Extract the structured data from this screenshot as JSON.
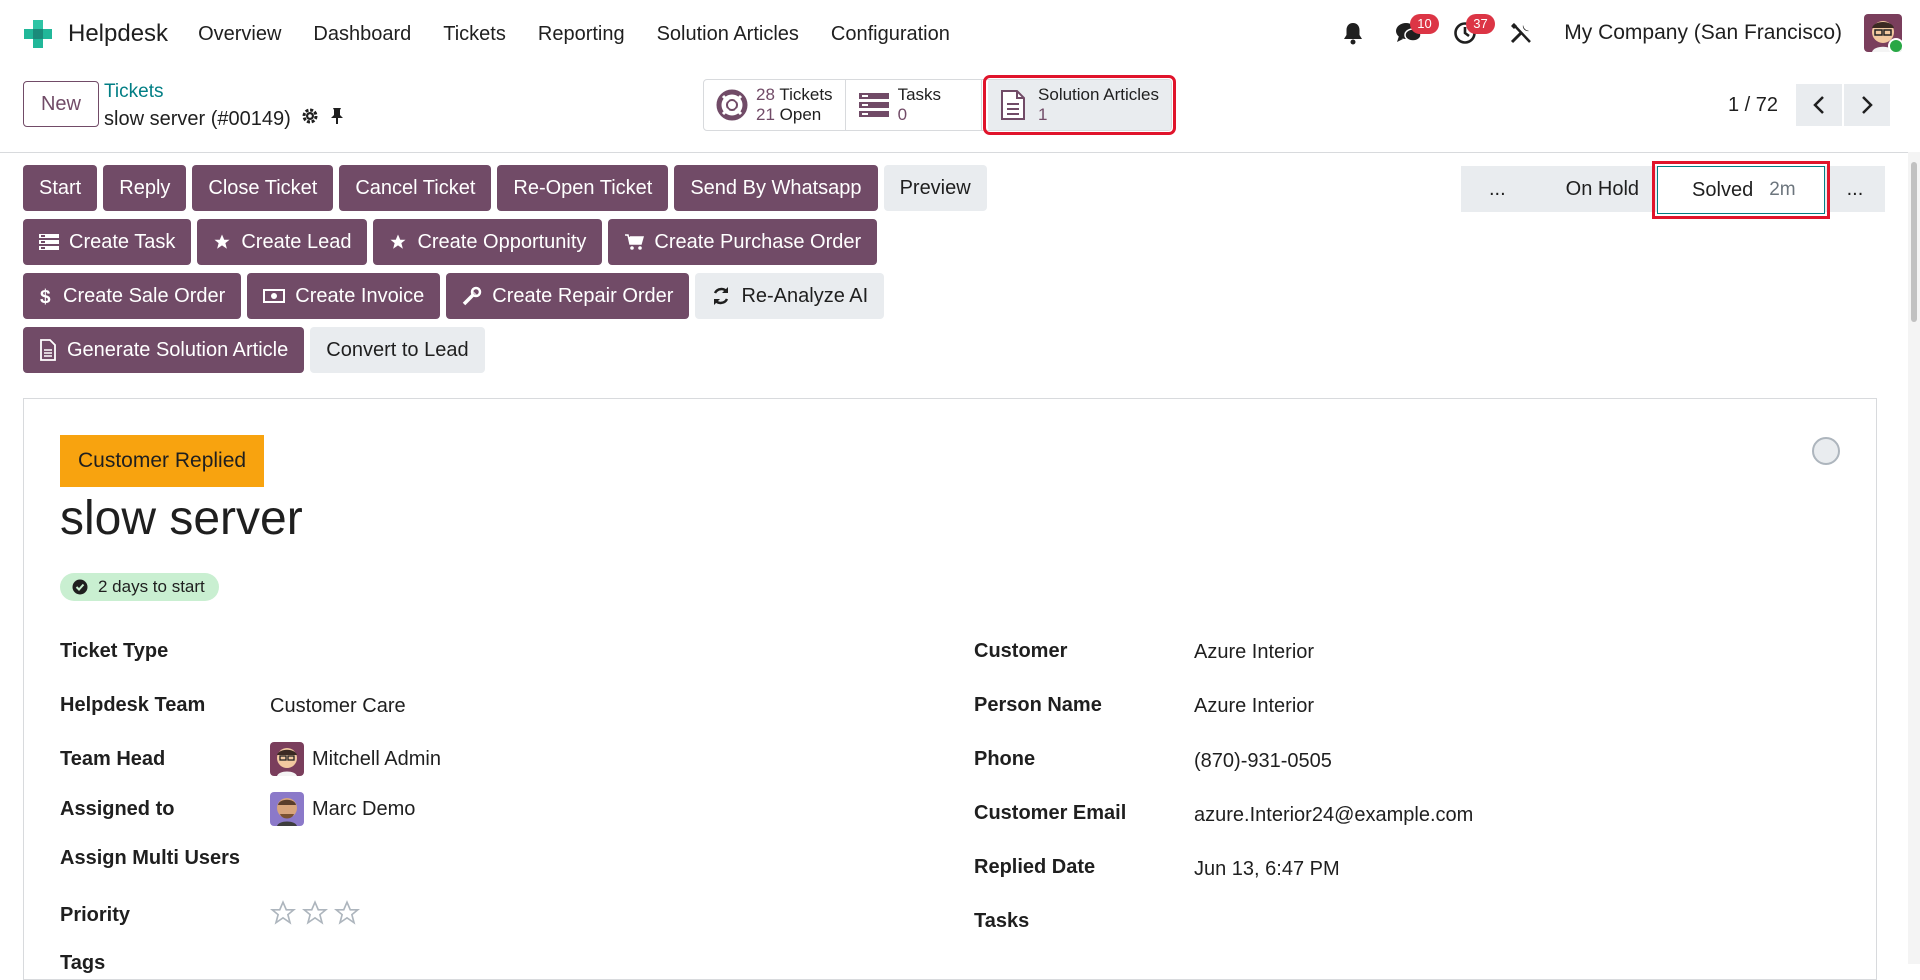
{
  "navbar": {
    "app_name": "Helpdesk",
    "menu": [
      "Overview",
      "Dashboard",
      "Tickets",
      "Reporting",
      "Solution Articles",
      "Configuration"
    ],
    "messages_count": "10",
    "activities_count": "37",
    "company": "My Company (San Francisco)"
  },
  "control": {
    "new_label": "New",
    "breadcrumb_parent": "Tickets",
    "record_name": "slow server (#00149)",
    "stats": {
      "tickets_num": "28",
      "tickets_label": "Tickets",
      "open_num": "21",
      "open_label": "Open",
      "tasks_label": "Tasks",
      "tasks_num": "0",
      "articles_label": "Solution Articles",
      "articles_num": "1"
    },
    "pager": "1 / 72"
  },
  "actions": {
    "row1": [
      "Start",
      "Reply",
      "Close Ticket",
      "Cancel Ticket",
      "Re-Open Ticket",
      "Send By Whatsapp",
      "Preview"
    ],
    "row2": [
      "Create Task",
      "Create Lead",
      "Create Opportunity",
      "Create Purchase Order"
    ],
    "row3": [
      "Create Sale Order",
      "Create Invoice",
      "Create Repair Order",
      "Re-Analyze AI"
    ],
    "row4": [
      "Generate Solution Article",
      "Convert to Lead"
    ]
  },
  "statusbar": {
    "prev_dots": "...",
    "on_hold": "On Hold",
    "solved": "Solved",
    "solved_time": "2m",
    "next_dots": "..."
  },
  "form": {
    "tag": "Customer Replied",
    "title": "slow server",
    "days_badge": "2 days to start",
    "left": {
      "ticket_type_label": "Ticket Type",
      "team_label": "Helpdesk Team",
      "team_value": "Customer Care",
      "team_head_label": "Team Head",
      "team_head_value": "Mitchell Admin",
      "assigned_label": "Assigned to",
      "assigned_value": "Marc Demo",
      "multi_users_label": "Assign Multi Users",
      "priority_label": "Priority",
      "priority_stars": 0,
      "priority_max": 3,
      "tags_label": "Tags"
    },
    "right": {
      "customer_label": "Customer",
      "customer_value": "Azure Interior",
      "person_label": "Person Name",
      "person_value": "Azure Interior",
      "phone_label": "Phone",
      "phone_value": "(870)-931-0505",
      "email_label": "Customer Email",
      "email_value": "azure.Interior24@example.com",
      "replied_label": "Replied Date",
      "replied_value": "Jun 13, 6:47 PM",
      "tasks_label": "Tasks"
    }
  },
  "colors": {
    "primary": "#714b67",
    "link": "#017e84",
    "tag": "#f8a30f",
    "badge": "#dc3545",
    "highlight": "#e0142b"
  }
}
